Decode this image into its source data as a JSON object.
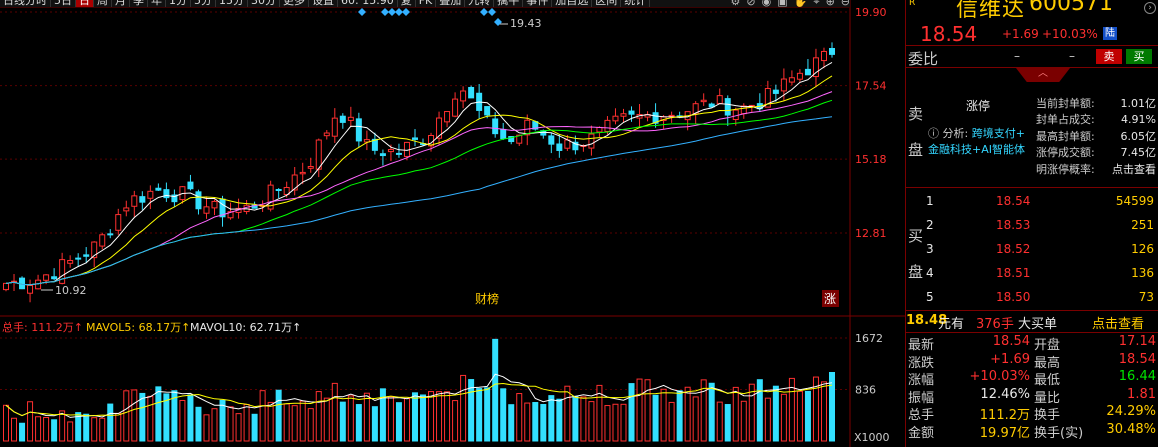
{
  "toolbar": {
    "items": [
      "日线分时",
      "5日",
      "日",
      "周",
      "月",
      "季",
      "年",
      "1分",
      "5分",
      "15分",
      "30分",
      "更多",
      "设置",
      "60: 15.90",
      "复",
      "FK",
      "叠加",
      "九转",
      "擒牛",
      "事件",
      "加自选",
      "区间",
      "统计"
    ],
    "active_index": 2
  },
  "stock": {
    "badge": "R",
    "name": "信维达",
    "code": "600571",
    "last": "18.54",
    "change": "+1.69",
    "change_pct": "+10.03%",
    "market_badge": "陆"
  },
  "weibi": {
    "label": "委比",
    "value1": "–",
    "value2": "–",
    "buy_label": "买",
    "sell_label": "卖"
  },
  "sell_side": {
    "label_top": "卖",
    "label_bottom": "盘",
    "status": "涨停",
    "analysis_prefix": "分析:",
    "analysis_link1": "跨境支付+",
    "analysis_link2": "金融科技+AI智能体"
  },
  "seal": [
    {
      "label": "当前封单额:",
      "value": "1.01亿"
    },
    {
      "label": "封单占成交:",
      "value": "4.91%"
    },
    {
      "label": "最高封单额:",
      "value": "6.05亿"
    },
    {
      "label": "涨停成交额:",
      "value": "7.45亿"
    },
    {
      "label": "明涨停概率:",
      "value": "点击查看"
    }
  ],
  "buy_side": {
    "label_top": "买",
    "label_bottom": "盘",
    "orders": [
      {
        "level": "1",
        "price": "18.54",
        "volume": "54599"
      },
      {
        "level": "2",
        "price": "18.53",
        "volume": "251"
      },
      {
        "level": "3",
        "price": "18.52",
        "volume": "126"
      },
      {
        "level": "4",
        "price": "18.51",
        "volume": "136"
      },
      {
        "level": "5",
        "price": "18.50",
        "volume": "73"
      }
    ]
  },
  "big_buy": {
    "price": "18.48",
    "unit": "元有",
    "volume": "376手",
    "label": "大买单",
    "link": "点击查看"
  },
  "stats": [
    {
      "l1": "最新",
      "v1": "18.54",
      "c1": "red",
      "l2": "开盘",
      "v2": "17.14",
      "c2": "red"
    },
    {
      "l1": "涨跌",
      "v1": "+1.69",
      "c1": "red",
      "l2": "最高",
      "v2": "18.54",
      "c2": "red"
    },
    {
      "l1": "涨幅",
      "v1": "+10.03%",
      "c1": "red",
      "l2": "最低",
      "v2": "16.44",
      "c2": "grn"
    },
    {
      "l1": "振幅",
      "v1": "12.46%",
      "c1": "wht",
      "l2": "量比",
      "v2": "1.81",
      "c2": "red"
    },
    {
      "l1": "总手",
      "v1": "111.2万",
      "c1": "ylw",
      "l2": "换手",
      "v2": "24.29%",
      "c2": "ylw"
    },
    {
      "l1": "金额",
      "v1": "19.97亿",
      "c1": "ylw",
      "l2": "换手(实)",
      "v2": "30.48%",
      "c2": "ylw"
    }
  ],
  "kline": {
    "price_ticks": [
      "19.90",
      "17.54",
      "15.18",
      "12.81"
    ],
    "high_label": "19.43",
    "low_label": "10.92",
    "event_label": "财榜",
    "limit_label": "涨",
    "volume_legend": {
      "total": "总手: 111.2万↑",
      "ma5": "MAVOL5: 68.17万↑",
      "ma10": "MAVOL10: 62.71万↑"
    },
    "volume_ticks": [
      "1672",
      "836"
    ],
    "volume_unit": "X1000",
    "colors": {
      "up": "#ff3030",
      "down": "#33e0ff",
      "ma5": "#ffffff",
      "ma10": "#ffff00",
      "ma20": "#ff66ff",
      "ma30": "#00ff00",
      "ma60": "#33b0ff"
    }
  }
}
